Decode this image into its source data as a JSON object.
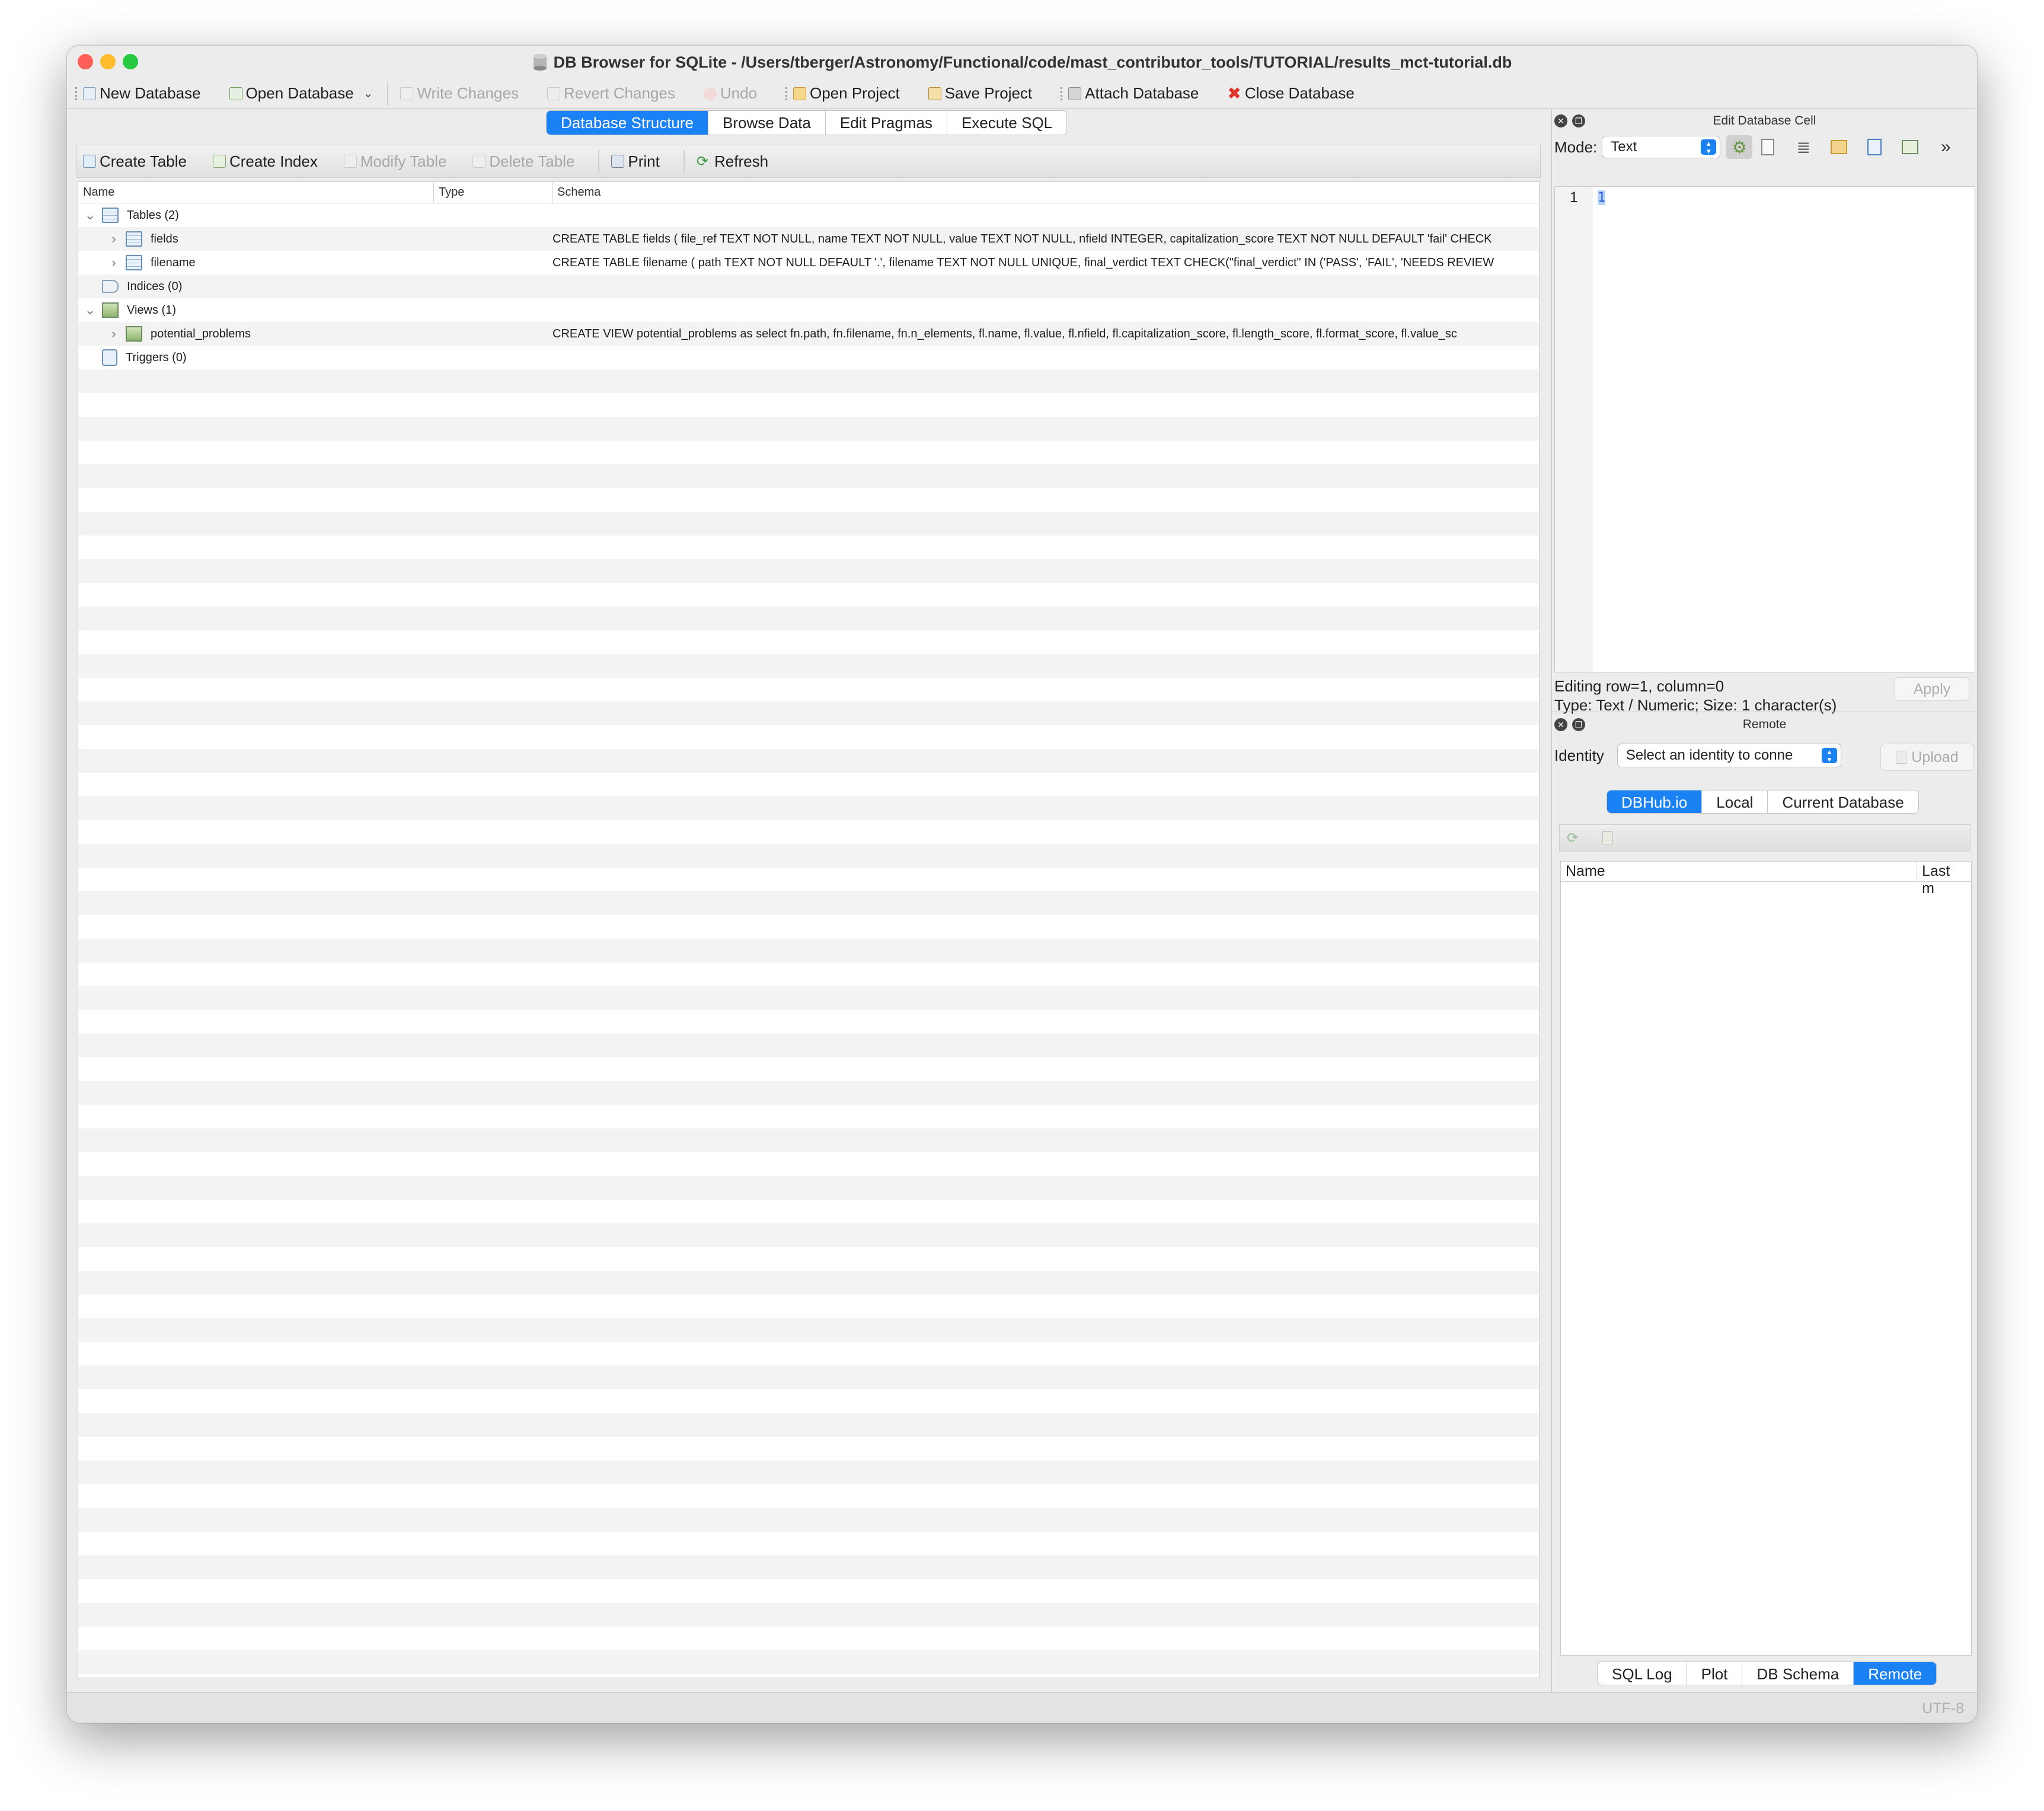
{
  "window": {
    "title": "DB Browser for SQLite - /Users/tberger/Astronomy/Functional/code/mast_contributor_tools/TUTORIAL/results_mct-tutorial.db"
  },
  "toolbar": {
    "new_database": "New Database",
    "open_database": "Open Database",
    "write_changes": "Write Changes",
    "revert_changes": "Revert Changes",
    "undo": "Undo",
    "open_project": "Open Project",
    "save_project": "Save Project",
    "attach_database": "Attach Database",
    "close_database": "Close Database"
  },
  "main_tabs": [
    "Database Structure",
    "Browse Data",
    "Edit Pragmas",
    "Execute SQL"
  ],
  "structure_toolbar": {
    "create_table": "Create Table",
    "create_index": "Create Index",
    "modify_table": "Modify Table",
    "delete_table": "Delete Table",
    "print": "Print",
    "refresh": "Refresh"
  },
  "tree": {
    "columns": [
      "Name",
      "Type",
      "Schema"
    ],
    "tables_group": "Tables (2)",
    "fields_name": "fields",
    "fields_schema": "CREATE TABLE fields ( file_ref TEXT NOT NULL, name TEXT NOT NULL, value TEXT NOT NULL, nfield INTEGER, capitalization_score TEXT NOT NULL DEFAULT 'fail' CHECK",
    "filename_name": "filename",
    "filename_schema": "CREATE TABLE filename ( path TEXT NOT NULL DEFAULT '.', filename TEXT NOT NULL UNIQUE, final_verdict TEXT CHECK(\"final_verdict\" IN ('PASS', 'FAIL', 'NEEDS REVIEW",
    "indices_group": "Indices (0)",
    "views_group": "Views (1)",
    "view_name": "potential_problems",
    "view_schema": "CREATE VIEW potential_problems as select fn.path, fn.filename, fn.n_elements, fl.name, fl.value, fl.nfield, fl.capitalization_score, fl.length_score, fl.format_score, fl.value_sc",
    "triggers_group": "Triggers (0)"
  },
  "edit_cell": {
    "title": "Edit Database Cell",
    "mode_label": "Mode:",
    "mode_value": "Text",
    "line_number": "1",
    "content": "1",
    "editing_status": "Editing row=1, column=0",
    "type_status": "Type: Text / Numeric; Size: 1 character(s)",
    "apply": "Apply"
  },
  "remote": {
    "title": "Remote",
    "identity_label": "Identity",
    "identity_placeholder": "Select an identity to conne",
    "upload": "Upload",
    "tabs": [
      "DBHub.io",
      "Local",
      "Current Database"
    ],
    "list_columns": [
      "Name",
      "Last m"
    ]
  },
  "bottom_tabs": [
    "SQL Log",
    "Plot",
    "DB Schema",
    "Remote"
  ],
  "status": {
    "encoding": "UTF-8"
  },
  "colors": {
    "accent": "#1a82f5",
    "close": "#ff5f57",
    "minimize": "#febc2e",
    "zoom": "#28c840"
  }
}
